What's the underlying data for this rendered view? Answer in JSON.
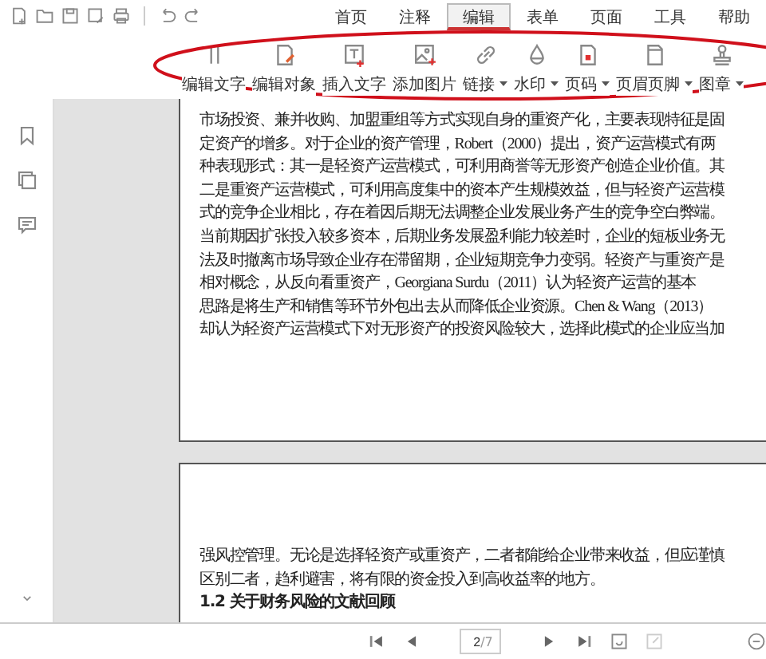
{
  "menu_tabs": [
    {
      "label": "首页",
      "selected": false
    },
    {
      "label": "注释",
      "selected": false
    },
    {
      "label": "编辑",
      "selected": true
    },
    {
      "label": "表单",
      "selected": false
    },
    {
      "label": "页面",
      "selected": false
    },
    {
      "label": "工具",
      "selected": false
    },
    {
      "label": "帮助",
      "selected": false
    }
  ],
  "ribbon": [
    {
      "label": "编辑文字",
      "dropdown": false
    },
    {
      "label": "编辑对象",
      "dropdown": false
    },
    {
      "label": "插入文字",
      "dropdown": false
    },
    {
      "label": "添加图片",
      "dropdown": false
    },
    {
      "label": "链接",
      "dropdown": true
    },
    {
      "label": "水印",
      "dropdown": true
    },
    {
      "label": "页码",
      "dropdown": true
    },
    {
      "label": "页眉页脚",
      "dropdown": true
    },
    {
      "label": "图章",
      "dropdown": true
    }
  ],
  "annotation": {
    "kind": "ellipse"
  },
  "pages": [
    {
      "lines": [
        {
          "text": "市场投资、兼并收购、加盟重组等方式实现自身的重资产化，主要表现特征是固",
          "kind": "body"
        },
        {
          "text": "定资产的增多。对于企业的资产管理，Robert（2000）提出，资产运营模式有两",
          "kind": "body"
        },
        {
          "text": "种表现形式：其一是轻资产运营模式，可利用商誉等无形资产创造企业价值。其",
          "kind": "body"
        },
        {
          "text": "二是重资产运营模式，可利用高度集中的资本产生规模效益，但与轻资产运营模",
          "kind": "body"
        },
        {
          "text": "式的竞争企业相比，存在着因后期无法调整企业发展业务产生的竞争空白弊端。",
          "kind": "body"
        },
        {
          "text": "当前期因扩张投入较多资本，后期业务发展盈利能力较差时，企业的短板业务无",
          "kind": "body"
        },
        {
          "text": "法及时撤离市场导致企业存在滞留期，企业短期竞争力变弱。轻资产与重资产是",
          "kind": "body"
        },
        {
          "text": "相对概念，从反向看重资产，Georgiana Surdu（2011）认为轻资产运营的基本",
          "kind": "body"
        },
        {
          "text": "思路是将生产和销售等环节外包出去从而降低企业资源。Chen & Wang（2013）",
          "kind": "body"
        },
        {
          "text": "却认为轻资产运营模式下对无形资产的投资风险较大，选择此模式的企业应当加",
          "kind": "body"
        }
      ]
    },
    {
      "lines": [
        {
          "text": "强风控管理。无论是选择轻资产或重资产，二者都能给企业带来收益，但应谨慎",
          "kind": "body"
        },
        {
          "text": "区别二者，趋利避害，将有限的资金投入到高收益率的地方。",
          "kind": "body"
        },
        {
          "text": "1.2 关于财务风险的文献回顾",
          "kind": "heading"
        }
      ]
    }
  ],
  "page_field": {
    "value": "2",
    "total": "/7"
  }
}
